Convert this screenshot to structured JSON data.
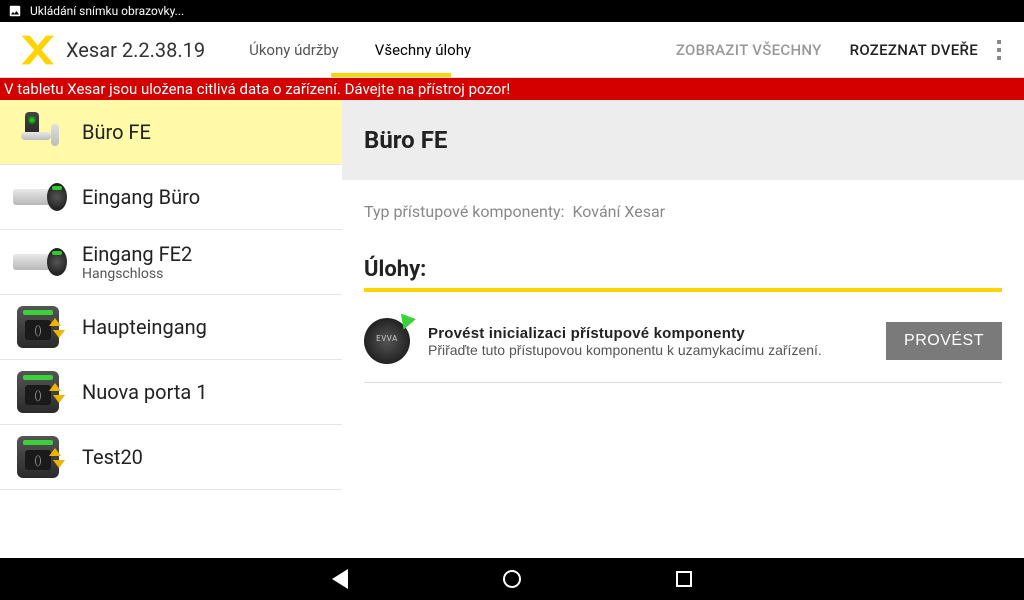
{
  "status_bar": {
    "text": "Ukládání snímku obrazovky..."
  },
  "app": {
    "title": "Xesar 2.2.38.19",
    "tabs": [
      {
        "label": "Úkony údržby",
        "active": false
      },
      {
        "label": "Všechny úlohy",
        "active": true
      }
    ],
    "actions": {
      "show_all": "ZOBRAZIT VŠECHNY",
      "recognize": "ROZEZNAT DVEŘE"
    }
  },
  "warning": "V tabletu Xesar jsou uložena citlivá data o zařízení. Dávejte na přístroj pozor!",
  "sidebar": {
    "items": [
      {
        "title": "Büro FE",
        "sub": "",
        "type": "handle",
        "selected": true
      },
      {
        "title": "Eingang Büro",
        "sub": "",
        "type": "cylinder",
        "selected": false
      },
      {
        "title": "Eingang FE2",
        "sub": "Hangschloss",
        "type": "cylinder",
        "selected": false
      },
      {
        "title": "Haupteingang",
        "sub": "",
        "type": "reader",
        "selected": false
      },
      {
        "title": "Nuova porta 1",
        "sub": "",
        "type": "reader",
        "selected": false
      },
      {
        "title": "Test20",
        "sub": "",
        "type": "reader",
        "selected": false
      }
    ]
  },
  "detail": {
    "title": "Büro FE",
    "type_label": "Typ přístupové komponenty:",
    "type_value": "Kování Xesar",
    "tasks_heading": "Úlohy:",
    "task": {
      "title": "Provést inicializaci přístupové komponenty",
      "sub": "Přiřaďte tuto přístupovou komponentu k uzamykacímu zařízení.",
      "button": "PROVÉST"
    }
  }
}
